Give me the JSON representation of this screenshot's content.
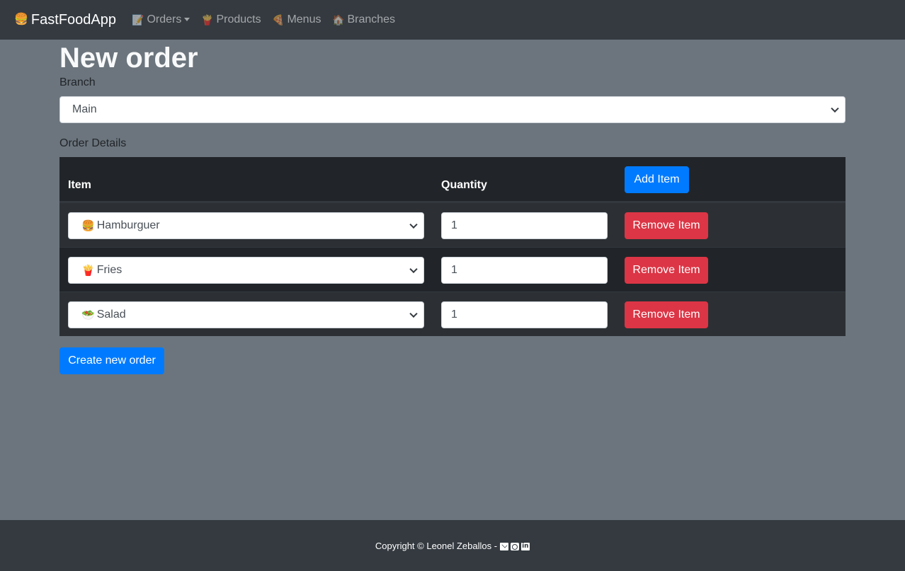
{
  "navbar": {
    "brand": {
      "icon": "🍔",
      "label": "FastFoodApp"
    },
    "items": [
      {
        "icon": "📝",
        "label": "Orders",
        "dropdown": true
      },
      {
        "icon": "🍟",
        "label": "Products"
      },
      {
        "icon": "🍕",
        "label": "Menus"
      },
      {
        "icon": "🏠",
        "label": "Branches"
      }
    ]
  },
  "page": {
    "title": "New order",
    "branch_label": "Branch",
    "branch_value": "Main",
    "details_label": "Order Details"
  },
  "table": {
    "headers": {
      "item": "Item",
      "quantity": "Quantity"
    },
    "add_button": "Add Item",
    "rows": [
      {
        "icon": "🍔",
        "item": "Hamburguer",
        "quantity": "1",
        "remove": "Remove Item"
      },
      {
        "icon": "🍟",
        "item": "Fries",
        "quantity": "1",
        "remove": "Remove Item"
      },
      {
        "icon": "🥗",
        "item": "Salad",
        "quantity": "1",
        "remove": "Remove Item"
      }
    ]
  },
  "submit_button": "Create new order",
  "footer": {
    "text": "Copyright © Leonel Zeballos -",
    "icons": [
      "mail-icon",
      "github-icon",
      "linkedin-icon"
    ]
  },
  "colors": {
    "navbar": "#343a40",
    "background": "#6c757d",
    "table": "#212529",
    "primary": "#007bff",
    "danger": "#dc3545"
  }
}
